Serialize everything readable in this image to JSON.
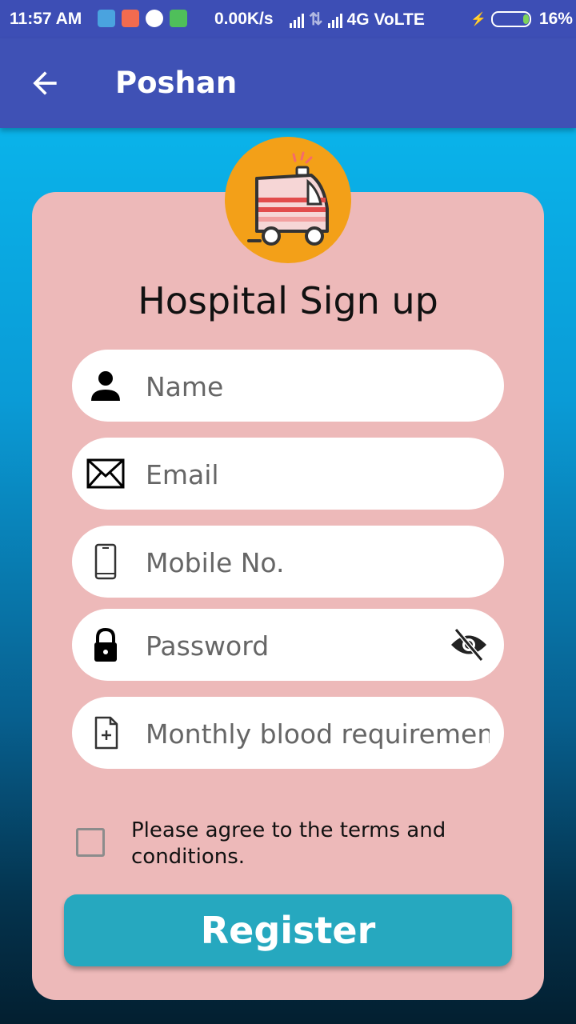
{
  "status_bar": {
    "time": "11:57 AM",
    "speed": "0.00K/s",
    "network": "4G VoLTE",
    "battery": "16%",
    "icons": [
      "usb-icon",
      "shopping-icon",
      "photos-icon",
      "frog-icon"
    ]
  },
  "app_bar": {
    "title": "Poshan",
    "back_icon": "arrow-left-icon"
  },
  "form": {
    "heading": "Hospital Sign up",
    "logo_icon": "ambulance-icon",
    "fields": [
      {
        "placeholder": "Name",
        "value": "",
        "icon": "person-icon"
      },
      {
        "placeholder": "Email",
        "value": "",
        "icon": "envelope-icon"
      },
      {
        "placeholder": "Mobile No.",
        "value": "",
        "icon": "phone-icon"
      },
      {
        "placeholder": "Password",
        "value": "",
        "icon": "lock-icon",
        "toggle_icon": "eye-off-icon"
      },
      {
        "placeholder": "Monthly blood requirement",
        "value": "",
        "icon": "document-plus-icon"
      }
    ],
    "terms_label": "Please agree to the terms and conditions.",
    "terms_checked": false,
    "register_label": "Register"
  },
  "colors": {
    "app_bar": "#3f51b5",
    "card": "#edb9b9",
    "register": "#26a8bf",
    "logo_bg": "#f3a018"
  }
}
